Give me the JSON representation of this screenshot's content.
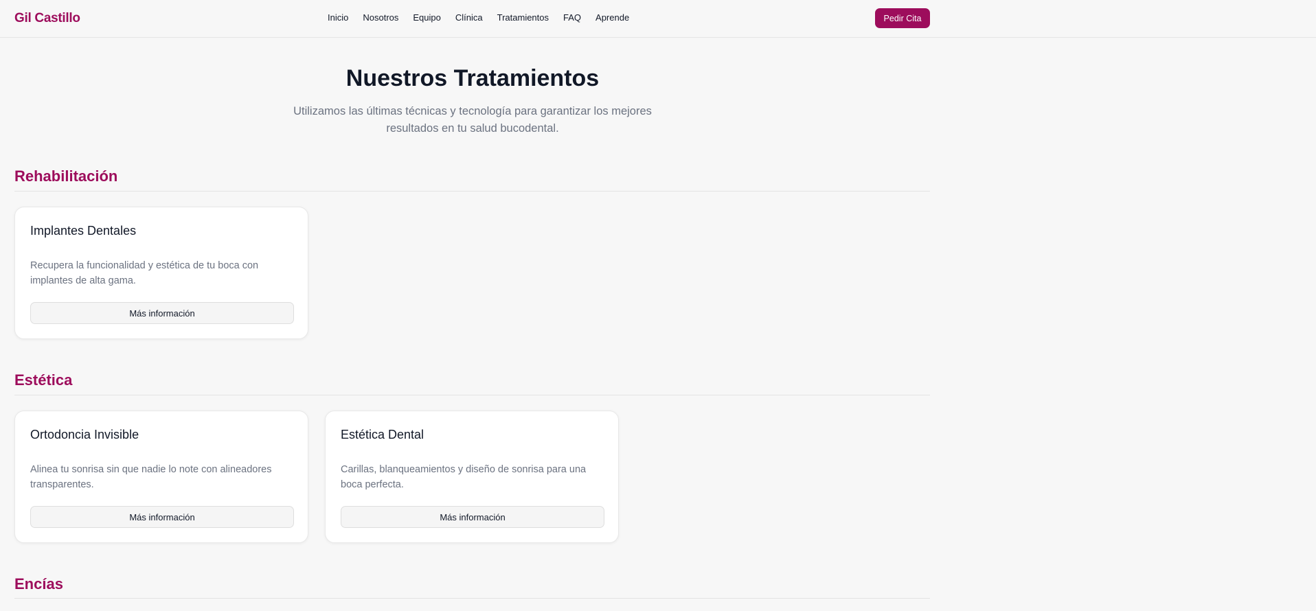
{
  "header": {
    "logo": "Gil Castillo",
    "nav": [
      "Inicio",
      "Nosotros",
      "Equipo",
      "Clínica",
      "Tratamientos",
      "FAQ",
      "Aprende"
    ],
    "cta": "Pedir Cita"
  },
  "hero": {
    "title": "Nuestros Tratamientos",
    "subtitle": "Utilizamos las últimas técnicas y tecnología para garantizar los mejores resultados en tu salud bucodental."
  },
  "sections": [
    {
      "title": "Rehabilitación",
      "cards": [
        {
          "title": "Implantes Dentales",
          "description": "Recupera la funcionalidad y estética de tu boca con implantes de alta gama.",
          "button": "Más información"
        }
      ]
    },
    {
      "title": "Estética",
      "cards": [
        {
          "title": "Ortodoncia Invisible",
          "description": "Alinea tu sonrisa sin que nadie lo note con alineadores transparentes.",
          "button": "Más información"
        },
        {
          "title": "Estética Dental",
          "description": "Carillas, blanqueamientos y diseño de sonrisa para una boca perfecta.",
          "button": "Más información"
        }
      ]
    },
    {
      "title": "Encías",
      "cards": []
    }
  ],
  "colors": {
    "accent": "#9d0d5c",
    "background": "#f7f7f7",
    "text": "#111827",
    "muted": "#6b7280"
  }
}
